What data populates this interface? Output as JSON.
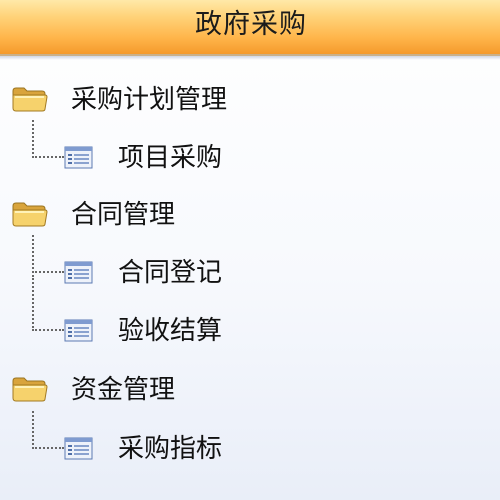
{
  "header": {
    "title": "政府采购"
  },
  "tree": [
    {
      "label": "采购计划管理",
      "icon": "folder-icon",
      "children": [
        {
          "label": "项目采购",
          "icon": "list-icon"
        }
      ]
    },
    {
      "label": "合同管理",
      "icon": "folder-icon",
      "children": [
        {
          "label": "合同登记",
          "icon": "list-icon"
        },
        {
          "label": "验收结算",
          "icon": "list-icon"
        }
      ]
    },
    {
      "label": "资金管理",
      "icon": "folder-icon",
      "children": [
        {
          "label": "采购指标",
          "icon": "list-icon"
        }
      ]
    }
  ],
  "colors": {
    "header_top": "#ffe9a8",
    "header_bottom": "#f49a2c",
    "folder": "#f3c75e",
    "list_icon": "#4f6fa8"
  }
}
